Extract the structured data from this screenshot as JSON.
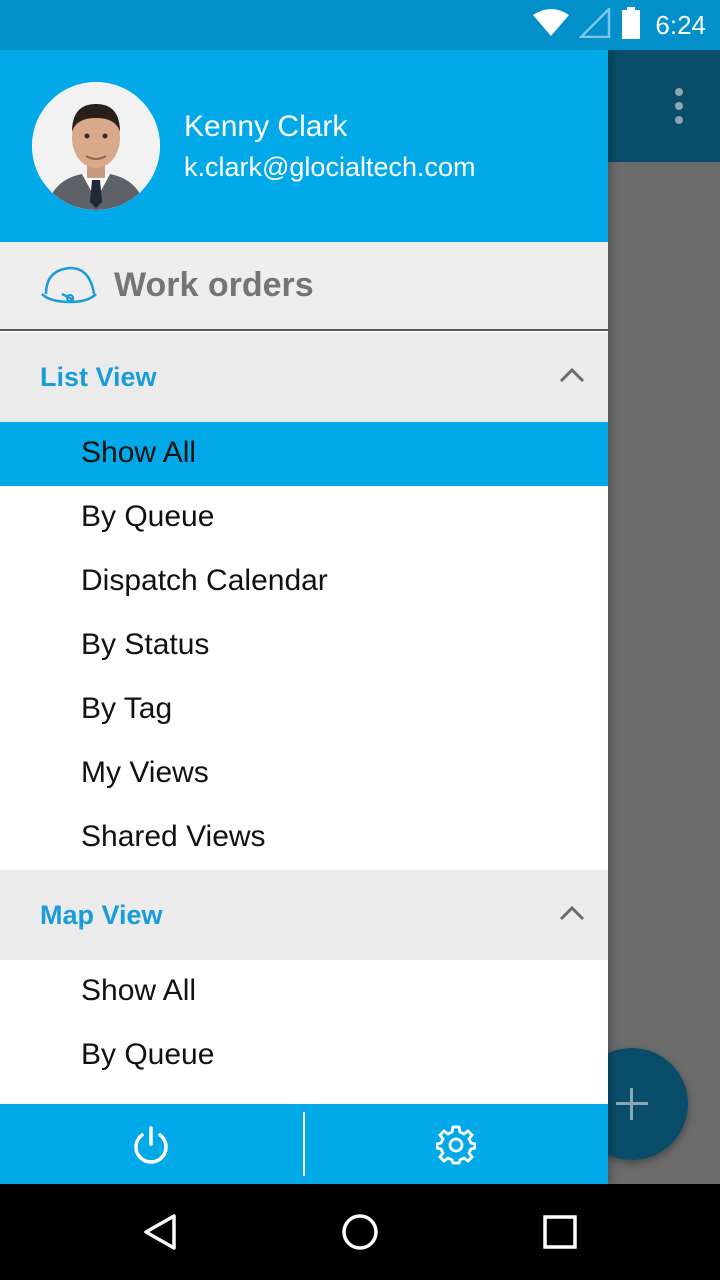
{
  "status_bar": {
    "time": "6:24",
    "icons": [
      "wifi-icon",
      "cell-signal-icon",
      "battery-icon"
    ]
  },
  "drawer": {
    "profile": {
      "name": "Kenny Clark",
      "email": "k.clark@glocialtech.com"
    },
    "module": {
      "icon": "hard-hat-icon",
      "title": "Work orders"
    },
    "sections": [
      {
        "title": "List View",
        "expanded": true,
        "items": [
          {
            "label": "Show All",
            "selected": true
          },
          {
            "label": "By Queue",
            "selected": false
          },
          {
            "label": "Dispatch Calendar",
            "selected": false
          },
          {
            "label": "By Status",
            "selected": false
          },
          {
            "label": "By Tag",
            "selected": false
          },
          {
            "label": "My Views",
            "selected": false
          },
          {
            "label": "Shared Views",
            "selected": false
          }
        ]
      },
      {
        "title": "Map View",
        "expanded": true,
        "items": [
          {
            "label": "Show All",
            "selected": false
          },
          {
            "label": "By Queue",
            "selected": false
          }
        ]
      }
    ],
    "bottom_bar": {
      "left_icon": "power-icon",
      "right_icon": "gear-icon"
    }
  },
  "background_app": {
    "overflow_icon": "more-vert-icon",
    "fab_icon": "plus-icon"
  },
  "nav_bar": {
    "icons": [
      "back-icon",
      "home-icon",
      "recents-icon"
    ]
  },
  "colors": {
    "drawer_header": "#02a9e9",
    "status_bar": "#0190c9",
    "section_title": "#1a9cd8",
    "selected_item": "#02a9e9",
    "app_bar": "#0a4d6b"
  }
}
